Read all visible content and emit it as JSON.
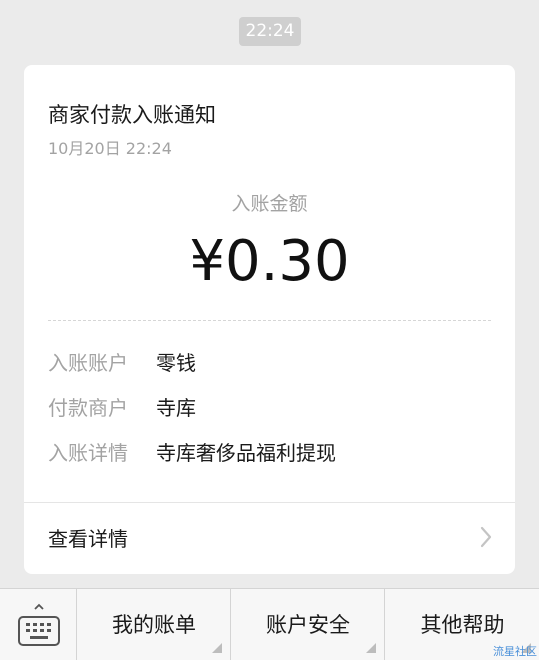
{
  "chat": {
    "timestamp": "22:24"
  },
  "card": {
    "title": "商家付款入账通知",
    "date": "10月20日  22:24",
    "amount_label": "入账金额",
    "amount": "¥0.30",
    "rows": [
      {
        "key": "入账账户",
        "value": "零钱"
      },
      {
        "key": "付款商户",
        "value": "寺库"
      },
      {
        "key": "入账详情",
        "value": "寺库奢侈品福利提现"
      }
    ],
    "detail_link": "查看详情"
  },
  "bottom_menu": {
    "keyboard_icon": "keyboard-icon",
    "items": [
      {
        "label": "我的账单"
      },
      {
        "label": "账户安全"
      },
      {
        "label": "其他帮助"
      }
    ]
  },
  "watermark": "流星社区"
}
